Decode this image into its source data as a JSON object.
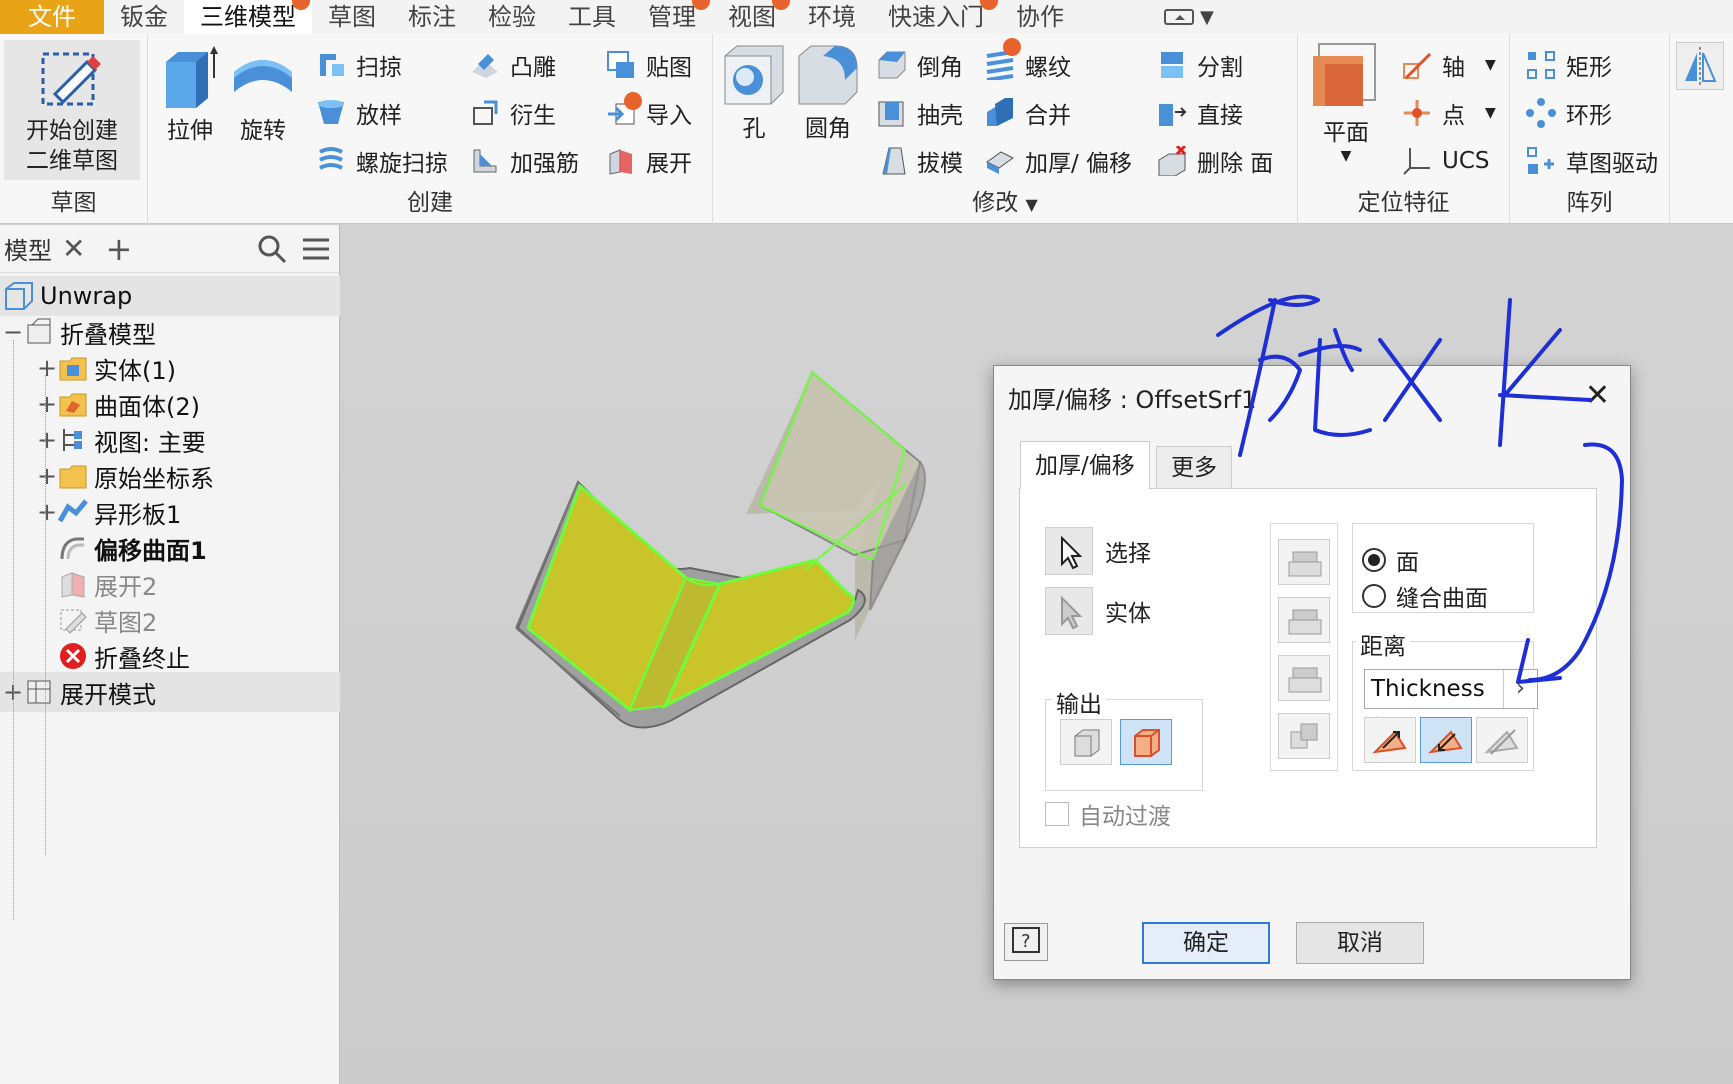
{
  "menu": {
    "tabs": [
      {
        "label": "文件",
        "badge": false
      },
      {
        "label": "钣金",
        "badge": false
      },
      {
        "label": "三维模型",
        "badge": true
      },
      {
        "label": "草图",
        "badge": false
      },
      {
        "label": "标注",
        "badge": false
      },
      {
        "label": "检验",
        "badge": false
      },
      {
        "label": "工具",
        "badge": false
      },
      {
        "label": "管理",
        "badge": true
      },
      {
        "label": "视图",
        "badge": true
      },
      {
        "label": "环境",
        "badge": false
      },
      {
        "label": "快速入门",
        "badge": true
      },
      {
        "label": "协作",
        "badge": false
      }
    ],
    "active_tab": "三维模型"
  },
  "ribbon": {
    "sketch_panel": {
      "title": "草图",
      "start_sketch_line1": "开始创建",
      "start_sketch_line2": "二维草图"
    },
    "create_panel": {
      "title": "创建",
      "extrude": "拉伸",
      "revolve": "旋转",
      "sweep": "扫掠",
      "loft": "放样",
      "coil": "螺旋扫掠",
      "emboss": "凸雕",
      "derive": "衍生",
      "rib": "加强筋",
      "decal": "贴图",
      "import": "导入",
      "unfold": "展开"
    },
    "modify_panel": {
      "title": "修改",
      "hole": "孔",
      "fillet": "圆角",
      "chamfer": "倒角",
      "shell": "抽壳",
      "draft": "拔模",
      "thread": "螺纹",
      "combine": "合并",
      "thicken": "加厚/ 偏移",
      "split": "分割",
      "direct": "直接",
      "delete_face": "删除 面"
    },
    "workfeatures_panel": {
      "title": "定位特征",
      "plane": "平面",
      "axis": "轴",
      "point": "点",
      "ucs": "UCS"
    },
    "pattern_panel": {
      "title": "阵列",
      "rect": "矩形",
      "circ": "环形",
      "sketch_driven": "草图驱动"
    }
  },
  "browser": {
    "tab": "模型",
    "root": "Unwrap",
    "items": [
      {
        "label": "折叠模型",
        "expander": "−",
        "style": "normal",
        "icon": "folded-model-icon"
      },
      {
        "label": "实体(1)",
        "expander": "+",
        "style": "normal",
        "icon": "solid-bodies-folder-icon"
      },
      {
        "label": "曲面体(2)",
        "expander": "+",
        "style": "normal",
        "icon": "surface-bodies-folder-icon"
      },
      {
        "label": "视图: 主要",
        "expander": "+",
        "style": "normal",
        "icon": "view-rep-icon"
      },
      {
        "label": "原始坐标系",
        "expander": "+",
        "style": "normal",
        "icon": "origin-folder-icon"
      },
      {
        "label": "异形板1",
        "expander": "+",
        "style": "normal",
        "icon": "contour-flange-icon"
      },
      {
        "label": "偏移曲面1",
        "expander": "",
        "style": "bold",
        "icon": "offset-surface-icon"
      },
      {
        "label": "展开2",
        "expander": "",
        "style": "dim",
        "icon": "unwrap-icon"
      },
      {
        "label": "草图2",
        "expander": "",
        "style": "dim",
        "icon": "sketch-icon"
      },
      {
        "label": "折叠终止",
        "expander": "",
        "style": "normal",
        "icon": "end-of-folded-icon"
      },
      {
        "label": "展开模式",
        "expander": "+",
        "style": "normal",
        "icon": "flat-pattern-icon"
      }
    ]
  },
  "dialog": {
    "title": "加厚/偏移 : OffsetSrf1",
    "tabs": [
      "加厚/偏移",
      "更多"
    ],
    "select_label": "选择",
    "solid_label": "实体",
    "output_label": "输出",
    "radio_face": "面",
    "radio_quilt": "缝合曲面",
    "distance_label": "距离",
    "distance_value": "Thickness *",
    "auto_blend": "自动过渡",
    "ok": "确定",
    "cancel": "取消"
  },
  "colors": {
    "accent": "#e8a317",
    "badge": "#e8632c",
    "highlight_face": "#c8c42a",
    "edge_green": "#6aff3a",
    "annotation": "#1e2fd6"
  }
}
